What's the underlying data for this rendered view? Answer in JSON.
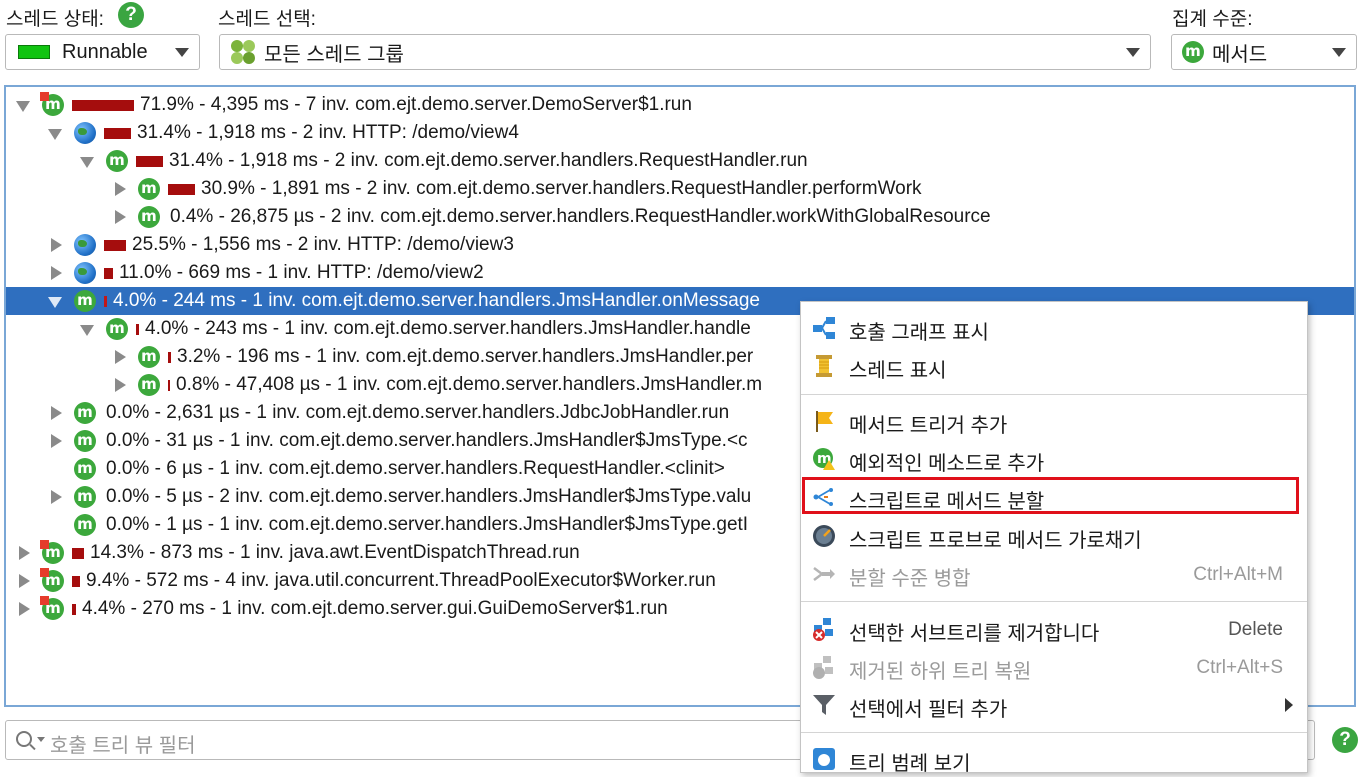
{
  "header": {
    "thread_state_label": "스레드 상태:",
    "thread_state_value": "Runnable",
    "thread_select_label": "스레드 선택:",
    "thread_select_value": "모든 스레드 그룹",
    "aggregation_label": "집계 수준:",
    "aggregation_value": "메서드",
    "help_glyph": "?"
  },
  "colors": {
    "selection": "#2f6fbf",
    "bar": "#a50d0d",
    "method_icon": "#3ca83c",
    "highlight_box": "#e0101a"
  },
  "tree": {
    "rows": [
      {
        "text": "71.9% - 4,395 ms - 7 inv. com.ejt.demo.server.DemoServer$1.run",
        "icon": "method-thread-icon",
        "state": "expanded",
        "bar": 0.719
      },
      {
        "text": "31.4% - 1,918 ms - 2 inv. HTTP: /demo/view4",
        "icon": "globe-icon",
        "state": "expanded",
        "bar": 0.314
      },
      {
        "text": "31.4% - 1,918 ms - 2 inv. com.ejt.demo.server.handlers.RequestHandler.run",
        "icon": "method-icon",
        "state": "expanded",
        "bar": 0.314
      },
      {
        "text": "30.9% - 1,891 ms - 2 inv. com.ejt.demo.server.handlers.RequestHandler.performWork",
        "icon": "method-icon",
        "state": "collapsed",
        "bar": 0.309
      },
      {
        "text": "0.4% - 26,875 µs - 2 inv. com.ejt.demo.server.handlers.RequestHandler.workWithGlobalResource",
        "icon": "method-icon",
        "state": "collapsed",
        "bar": 0.004
      },
      {
        "text": "25.5% - 1,556 ms - 2 inv. HTTP: /demo/view3",
        "icon": "globe-icon",
        "state": "collapsed",
        "bar": 0.255
      },
      {
        "text": "11.0% - 669 ms - 1 inv. HTTP: /demo/view2",
        "icon": "globe-icon",
        "state": "collapsed",
        "bar": 0.11
      },
      {
        "text": "4.0% - 244 ms - 1 inv. com.ejt.demo.server.handlers.JmsHandler.onMessage",
        "icon": "method-icon",
        "state": "expanded",
        "bar": 0.04,
        "selected": true
      },
      {
        "text": "4.0% - 243 ms - 1 inv. com.ejt.demo.server.handlers.JmsHandler.handle",
        "icon": "method-icon",
        "state": "expanded",
        "bar": 0.04
      },
      {
        "text": "3.2% - 196 ms - 1 inv. com.ejt.demo.server.handlers.JmsHandler.per",
        "icon": "method-icon",
        "state": "collapsed",
        "bar": 0.032
      },
      {
        "text": "0.8% - 47,408 µs - 1 inv. com.ejt.demo.server.handlers.JmsHandler.m",
        "icon": "method-icon",
        "state": "collapsed",
        "bar": 0.008
      },
      {
        "text": "0.0% - 2,631 µs - 1 inv. com.ejt.demo.server.handlers.JdbcJobHandler.run",
        "icon": "method-icon",
        "state": "collapsed",
        "bar": 0
      },
      {
        "text": "0.0% - 31 µs - 1 inv. com.ejt.demo.server.handlers.JmsHandler$JmsType.<c",
        "icon": "method-icon",
        "state": "collapsed",
        "bar": 0
      },
      {
        "text": "0.0% - 6 µs - 1 inv. com.ejt.demo.server.handlers.RequestHandler.<clinit>",
        "icon": "method-icon",
        "state": "leaf",
        "bar": 0
      },
      {
        "text": "0.0% - 5 µs - 2 inv. com.ejt.demo.server.handlers.JmsHandler$JmsType.valu",
        "icon": "method-icon",
        "state": "collapsed",
        "bar": 0
      },
      {
        "text": "0.0% - 1 µs - 1 inv. com.ejt.demo.server.handlers.JmsHandler$JmsType.getI",
        "icon": "method-icon",
        "state": "leaf",
        "bar": 0
      },
      {
        "text": "14.3% - 873 ms - 1 inv. java.awt.EventDispatchThread.run",
        "icon": "method-thread-icon",
        "state": "collapsed",
        "bar": 0.143
      },
      {
        "text": "9.4% - 572 ms - 4 inv. java.util.concurrent.ThreadPoolExecutor$Worker.run",
        "icon": "method-thread-icon",
        "state": "collapsed",
        "bar": 0.094
      },
      {
        "text": "4.4% - 270 ms - 1 inv. com.ejt.demo.server.gui.GuiDemoServer$1.run",
        "icon": "method-thread-icon",
        "state": "collapsed",
        "bar": 0.044
      }
    ]
  },
  "context_menu": {
    "items": [
      {
        "label": "호출 그래프 표시",
        "icon": "call-graph-icon",
        "enabled": true
      },
      {
        "label": "스레드 표시",
        "icon": "thread-spool-icon",
        "enabled": true
      },
      {
        "label": "메서드 트리거 추가",
        "icon": "flag-icon",
        "enabled": true
      },
      {
        "label": "예외적인 메소드로 추가",
        "icon": "exceptional-method-icon",
        "enabled": true
      },
      {
        "label": "스크립트로 메서드 분할",
        "icon": "split-icon",
        "enabled": true,
        "highlighted": true
      },
      {
        "label": "스크립트 프로브로 메서드 가로채기",
        "icon": "probe-gauge-icon",
        "enabled": true
      },
      {
        "label": "분할 수준 병합",
        "shortcut": "Ctrl+Alt+M",
        "icon": "merge-icon",
        "enabled": false
      },
      {
        "label": "선택한 서브트리를 제거합니다",
        "shortcut": "Delete",
        "icon": "remove-subtree-icon",
        "enabled": true
      },
      {
        "label": "제거된 하위 트리 복원",
        "shortcut": "Ctrl+Alt+S",
        "icon": "restore-subtree-icon",
        "enabled": false
      },
      {
        "label": "선택에서 필터 추가",
        "icon": "funnel-icon",
        "enabled": true,
        "submenu": true
      },
      {
        "label": "트리 범례 보기",
        "icon": "legend-icon",
        "enabled": true
      }
    ]
  },
  "filter": {
    "placeholder": "호출 트리 뷰 필터"
  }
}
